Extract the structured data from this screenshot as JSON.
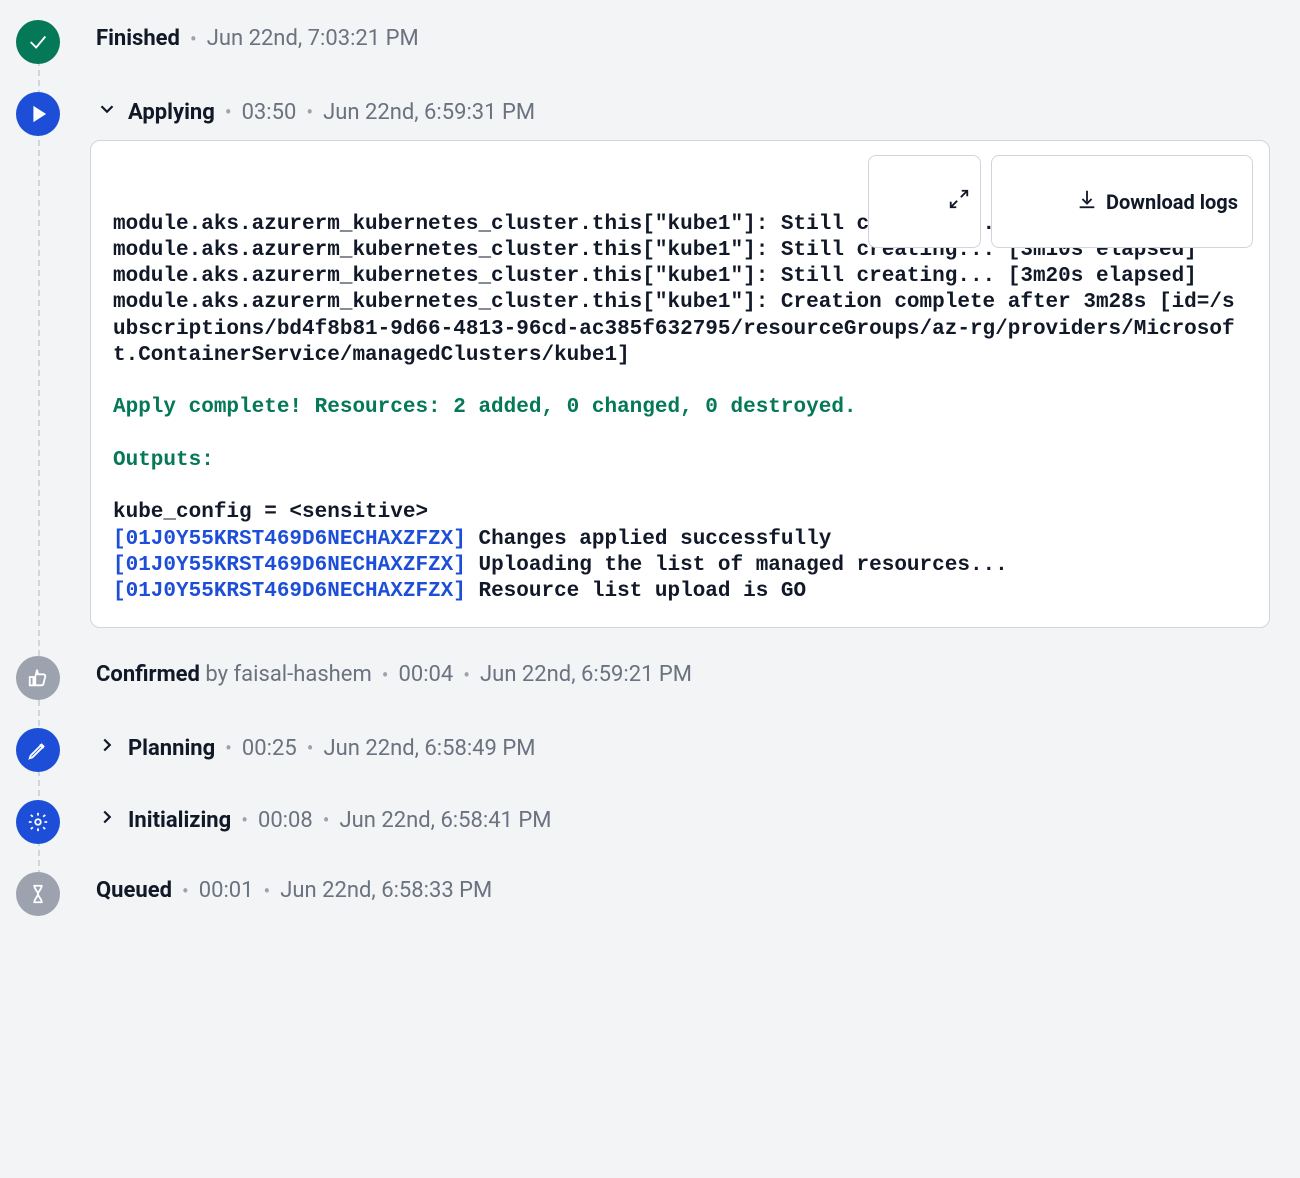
{
  "log_controls": {
    "download_label": "Download logs"
  },
  "steps": [
    {
      "id": "finished",
      "title": "Finished",
      "timestamp": "Jun 22nd, 7:03:21 PM"
    },
    {
      "id": "applying",
      "title": "Applying",
      "duration": "03:50",
      "timestamp": "Jun 22nd, 6:59:31 PM",
      "log_lines": [
        {
          "cls": "plain",
          "text": "module.aks.azurerm_kubernetes_cluster.this[\"kube1\"]: Still creating... [3m0s elapsed]"
        },
        {
          "cls": "plain",
          "text": "module.aks.azurerm_kubernetes_cluster.this[\"kube1\"]: Still creating... [3m10s elapsed]"
        },
        {
          "cls": "plain",
          "text": "module.aks.azurerm_kubernetes_cluster.this[\"kube1\"]: Still creating... [3m20s elapsed]"
        },
        {
          "cls": "plain",
          "text": "module.aks.azurerm_kubernetes_cluster.this[\"kube1\"]: Creation complete after 3m28s [id=/subscriptions/bd4f8b81-9d66-4813-96cd-ac385f632795/resourceGroups/az-rg/providers/Microsoft.ContainerService/managedClusters/kube1]"
        },
        {
          "cls": "plain",
          "text": ""
        },
        {
          "cls": "green",
          "text": "Apply complete! Resources: 2 added, 0 changed, 0 destroyed."
        },
        {
          "cls": "plain",
          "text": ""
        },
        {
          "cls": "green",
          "text": "Outputs:"
        },
        {
          "cls": "plain",
          "text": ""
        },
        {
          "cls": "plain",
          "text": "kube_config = <sensitive>"
        }
      ],
      "log_tagged": [
        {
          "tag": "[01J0Y55KRST469D6NECHAXZFZX]",
          "msg": " Changes applied successfully"
        },
        {
          "tag": "[01J0Y55KRST469D6NECHAXZFZX]",
          "msg": " Uploading the list of managed resources..."
        },
        {
          "tag": "[01J0Y55KRST469D6NECHAXZFZX]",
          "msg": " Resource list upload is GO"
        }
      ]
    },
    {
      "id": "confirmed",
      "title": "Confirmed",
      "by_label": " by ",
      "by_user": "faisal-hashem",
      "duration": "00:04",
      "timestamp": "Jun 22nd, 6:59:21 PM"
    },
    {
      "id": "planning",
      "title": "Planning",
      "duration": "00:25",
      "timestamp": "Jun 22nd, 6:58:49 PM"
    },
    {
      "id": "initializing",
      "title": "Initializing",
      "duration": "00:08",
      "timestamp": "Jun 22nd, 6:58:41 PM"
    },
    {
      "id": "queued",
      "title": "Queued",
      "duration": "00:01",
      "timestamp": "Jun 22nd, 6:58:33 PM"
    }
  ]
}
